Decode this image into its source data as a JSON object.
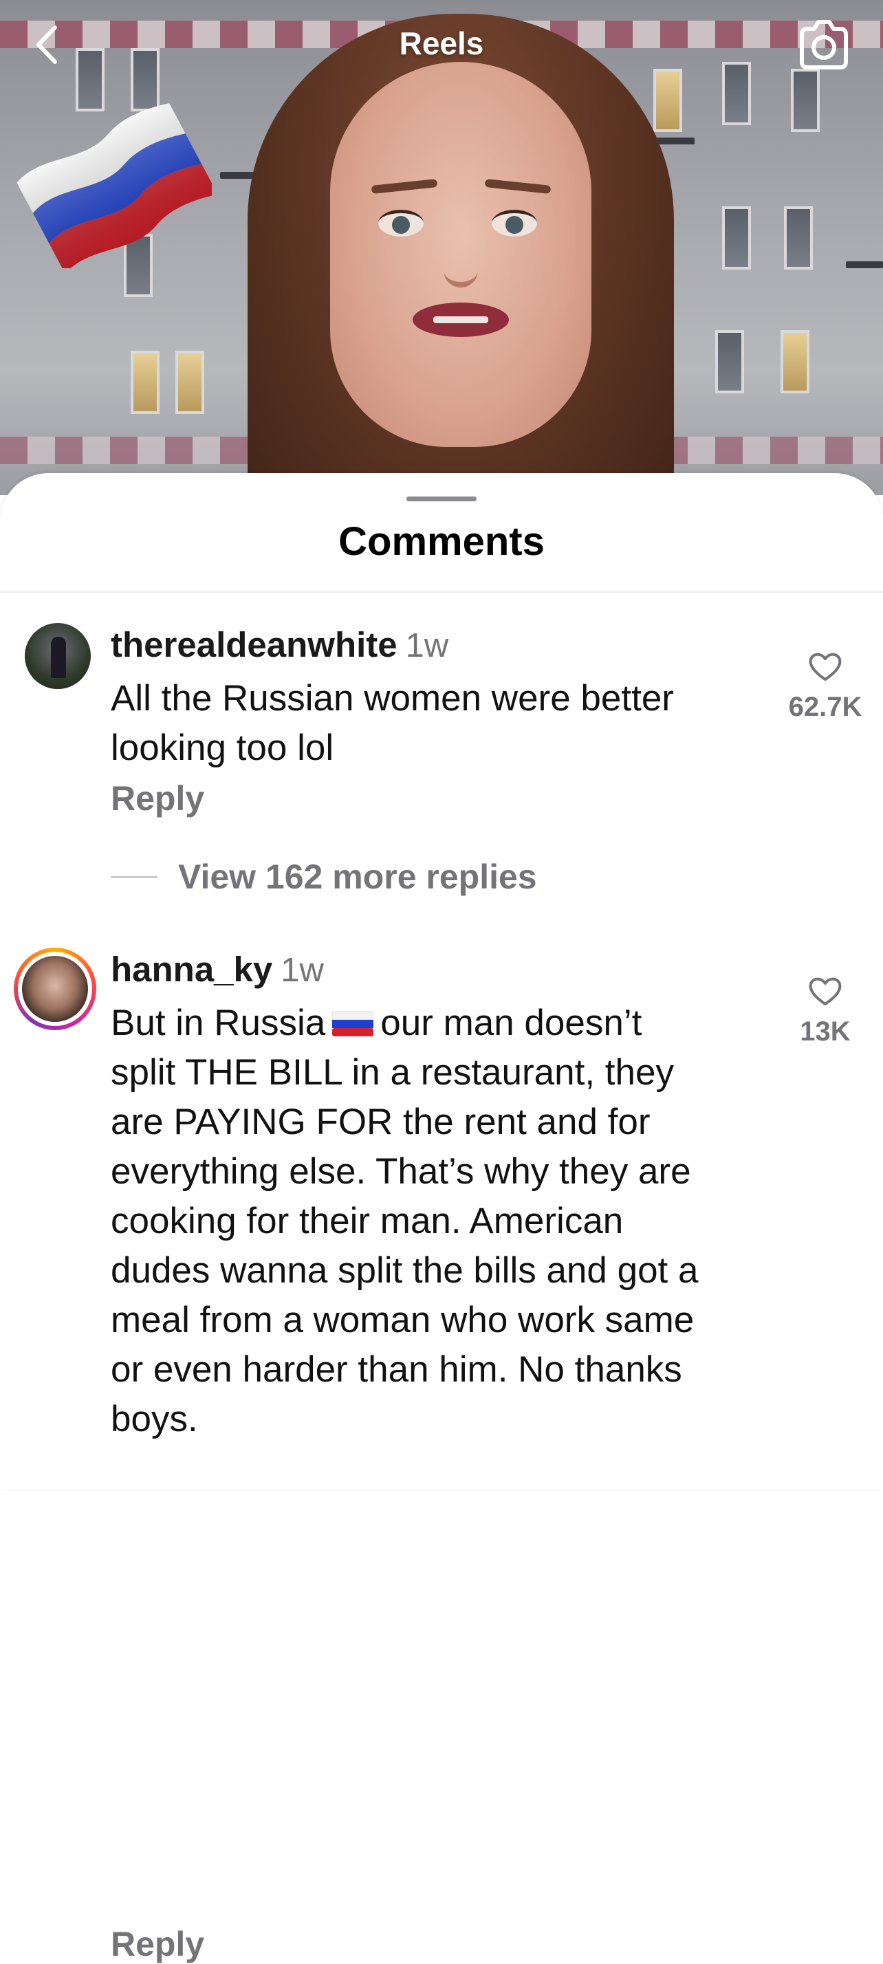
{
  "topbar": {
    "title": "Reels",
    "back_icon": "chevron-left-icon",
    "camera_icon": "camera-icon"
  },
  "video": {
    "sticker": "russian-flag-sticker",
    "flag_colors": [
      "#ffffff",
      "#1c3fd1",
      "#d6202b"
    ]
  },
  "sheet": {
    "title": "Comments"
  },
  "comments": [
    {
      "username": "therealdeanwhite",
      "time": "1w",
      "text": "All the Russian women were better\nlooking too lol",
      "reply_label": "Reply",
      "likes": "62.7K",
      "view_replies_label": "View 162 more replies"
    },
    {
      "username": "hanna_ky",
      "time": "1w",
      "text_before_flag": "But in Russia",
      "text_after_flag": "our man doesn’t",
      "text_rest": "split THE BILL in a restaurant, they\nare PAYING FOR the rent and for\neverything else. That’s why they are\ncooking for their man. American\ndudes wanna split the bills and got a\nmeal from a woman who work same\nor even harder than him. No thanks\nboys.",
      "reply_label": "Reply",
      "likes": "13K",
      "has_story_ring": true
    }
  ],
  "colors": {
    "secondary_text": "#737378",
    "story_ring": [
      "#ffb000",
      "#d6249f",
      "#8134af"
    ]
  }
}
